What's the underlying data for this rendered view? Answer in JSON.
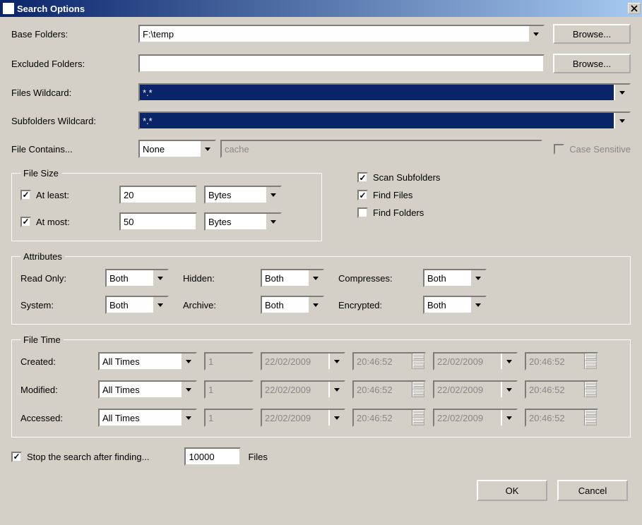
{
  "titlebar": {
    "title": "Search Options"
  },
  "labels": {
    "base_folders": "Base Folders:",
    "excluded_folders": "Excluded Folders:",
    "files_wildcard": "Files Wildcard:",
    "subfolders_wildcard": "Subfolders Wildcard:",
    "file_contains": "File Contains...",
    "case_sensitive": "Case Sensitive",
    "file_size": "File Size",
    "at_least": "At least:",
    "at_most": "At most:",
    "scan_subfolders": "Scan Subfolders",
    "find_files": "Find Files",
    "find_folders": "Find Folders",
    "attributes": "Attributes",
    "read_only": "Read Only:",
    "hidden": "Hidden:",
    "compresses": "Compresses:",
    "system": "System:",
    "archive": "Archive:",
    "encrypted": "Encrypted:",
    "file_time": "File Time",
    "created": "Created:",
    "modified": "Modified:",
    "accessed": "Accessed:",
    "stop_after": "Stop the search after finding...",
    "files": "Files"
  },
  "values": {
    "base_folders": "F:\\temp",
    "excluded_folders": "",
    "files_wildcard": "*.*",
    "subfolders_wildcard": "*.*",
    "file_contains_mode": "None",
    "file_contains_text": "cache",
    "at_least": "20",
    "at_most": "50",
    "size_unit_least": "Bytes",
    "size_unit_most": "Bytes",
    "attr_both": "Both",
    "time_mode": "All Times",
    "time_days": "1",
    "date1": "22/02/2009",
    "time1": "20:46:52",
    "stop_count": "10000"
  },
  "buttons": {
    "browse": "Browse...",
    "ok": "OK",
    "cancel": "Cancel"
  },
  "checks": {
    "at_least": true,
    "at_most": true,
    "scan_subfolders": true,
    "find_files": true,
    "find_folders": false,
    "case_sensitive": false,
    "stop_after": true
  }
}
